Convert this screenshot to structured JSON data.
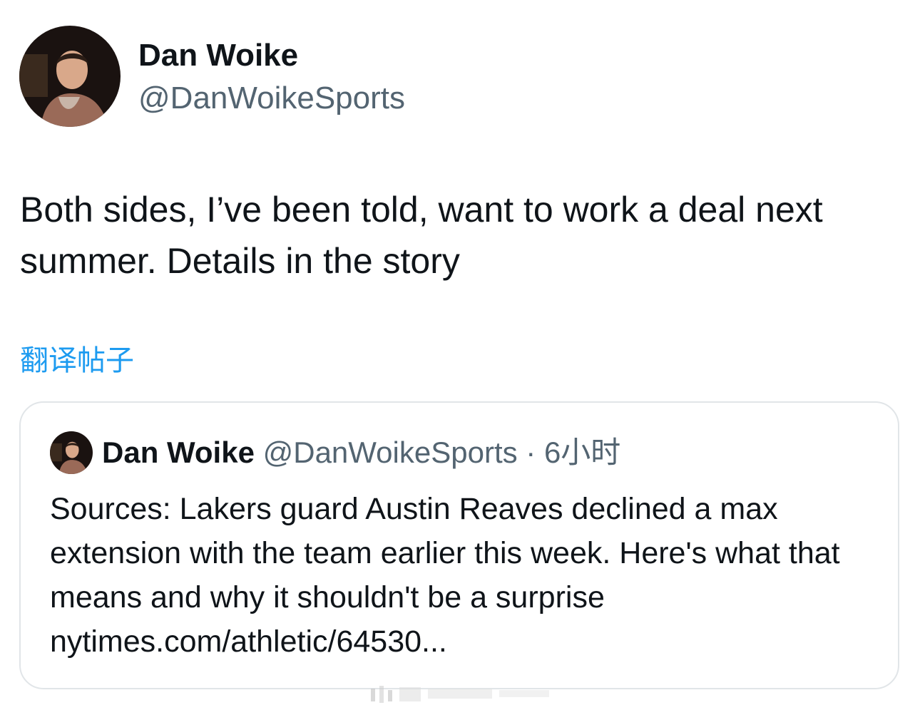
{
  "tweet": {
    "author_name": "Dan Woike",
    "author_handle": "@DanWoikeSports",
    "avatar_icon": "profile-photo",
    "text": "Both sides, I’ve been told, want to work a deal next summer. Details in the story",
    "translate_label": "翻译帖子"
  },
  "quote": {
    "author_name": "Dan Woike",
    "author_handle": "@DanWoikeSports",
    "separator": " · ",
    "time": "6小时",
    "avatar_icon": "profile-photo",
    "text": "Sources: Lakers guard Austin Reaves declined a max extension with the team earlier this week. Here's what that means and why it shouldn't be a surprise",
    "link_text": "nytimes.com/athletic/64530..."
  },
  "colors": {
    "text_primary": "#0f1419",
    "text_secondary": "#536471",
    "link": "#1d9bf0",
    "border": "#e1e5e8"
  }
}
